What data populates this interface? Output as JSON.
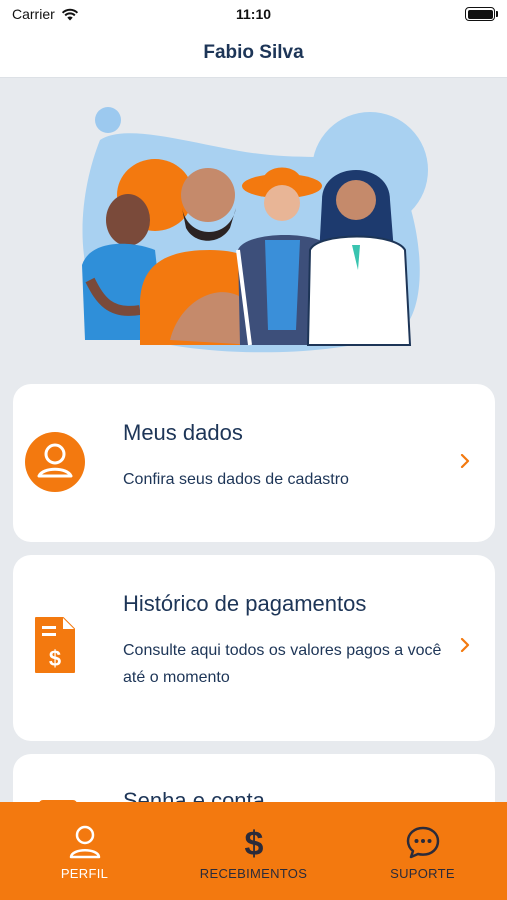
{
  "status_bar": {
    "carrier": "Carrier",
    "time": "11:10"
  },
  "header": {
    "title": "Fabio Silva"
  },
  "colors": {
    "accent": "#f3790f",
    "navy": "#1d3557",
    "background": "#e7eaee"
  },
  "cards": [
    {
      "title": "Meus dados",
      "description": "Confira seus dados de cadastro",
      "icon": "user-circle-icon"
    },
    {
      "title": "Histórico de pagamentos",
      "description": "Consulte aqui todos os valores pagos a você até o momento",
      "icon": "invoice-dollar-icon"
    },
    {
      "title": "Senha e conta",
      "icon": "lock-icon"
    }
  ],
  "tabs": [
    {
      "label": "PERFIL",
      "icon": "person-icon",
      "active": true
    },
    {
      "label": "RECEBIMENTOS",
      "icon": "dollar-icon",
      "active": false
    },
    {
      "label": "SUPORTE",
      "icon": "chat-bubble-icon",
      "active": false
    }
  ]
}
